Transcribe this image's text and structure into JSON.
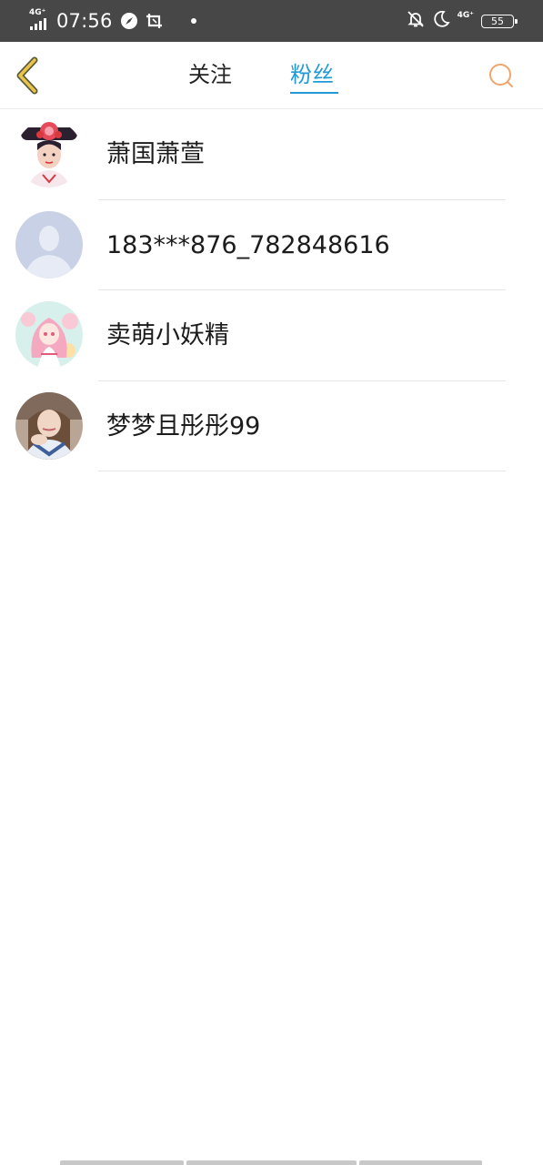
{
  "status_bar": {
    "network_left": "4G⁺",
    "time": "07:56",
    "network_right": "4G⁺",
    "battery": "55"
  },
  "header": {
    "back_icon": "chevron-left-icon",
    "tabs": [
      {
        "label": "关注",
        "active": false
      },
      {
        "label": "粉丝",
        "active": true
      }
    ],
    "search_icon": "search-icon"
  },
  "colors": {
    "status_bar_bg": "#474747",
    "active_tab": "#1f9ad6",
    "back_icon_yellow": "#e9c44b",
    "search_icon_orange": "#f0a66a",
    "divider": "#e5e5e5"
  },
  "fans": [
    {
      "name": "萧国萧萱",
      "avatar": "avatar-qing-costume"
    },
    {
      "name": "183***876_782848616",
      "avatar": "avatar-default-placeholder"
    },
    {
      "name": "卖萌小妖精",
      "avatar": "avatar-anime-girl"
    },
    {
      "name": "梦梦且彤彤99",
      "avatar": "avatar-photo-girl"
    }
  ]
}
